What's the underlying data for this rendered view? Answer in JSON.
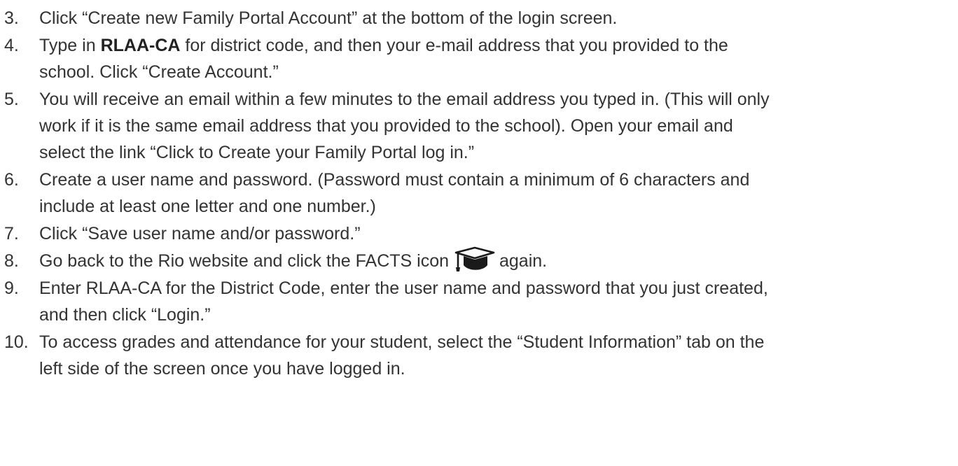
{
  "steps": [
    {
      "num": "3.",
      "lines": [
        "Click “Create new Family Portal Account” at the bottom of the login screen."
      ]
    },
    {
      "num": "4.",
      "pre": "Type in ",
      "bold": "RLAA-CA",
      "post": " for district code, and then your e-mail address that you provided to the",
      "line2": "school. Click “Create Account.”"
    },
    {
      "num": "5.",
      "lines": [
        "You will receive an email within a few minutes to the email address you typed in. (This will only",
        "work if it is the same email address that you provided to the school). Open your email and",
        "select the link “Click to Create your Family Portal log in.”"
      ]
    },
    {
      "num": "6.",
      "lines": [
        "Create a user name and password. (Password must contain a minimum of 6 characters and",
        "include at least one letter and one number.)"
      ]
    },
    {
      "num": "7.",
      "lines": [
        "Click “Save user name and/or password.”"
      ]
    },
    {
      "num": "8.",
      "pre": "Go back to the Rio website and click the FACTS icon",
      "post": "again.",
      "icon": "graduation-cap-icon"
    },
    {
      "num": "9.",
      "lines": [
        "Enter RLAA-CA for the District Code, enter the user name and password that you just created,",
        "and then click “Login.”"
      ]
    },
    {
      "num": "10.",
      "lines": [
        "To access grades and attendance for your student, select the “Student Information” tab on the",
        "left side of the screen once you have logged in."
      ]
    }
  ],
  "colors": {
    "text": "#333333",
    "icon": "#1a1a1a"
  }
}
